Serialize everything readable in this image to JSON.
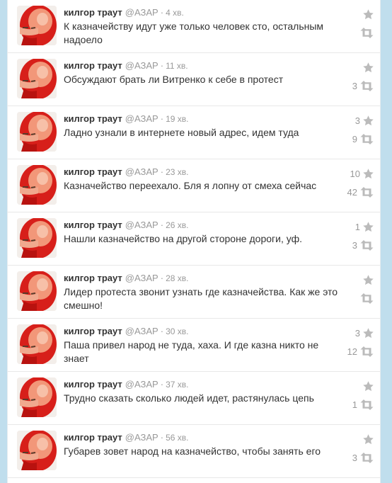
{
  "colors": {
    "background": "#c0deed",
    "icon": "#bbbbbb",
    "avatar_red": "#d71f1a",
    "avatar_skin": "#f29779"
  },
  "icons": {
    "favorite": "star-icon",
    "retweet": "retweet-icon"
  },
  "tweets": [
    {
      "name": "килгор траут",
      "handle": "@АЗАР",
      "time": "4 хв.",
      "text": "К казначейству идут уже только человек сто, остальным надоело",
      "favorites": "",
      "retweets": ""
    },
    {
      "name": "килгор траут",
      "handle": "@АЗАР",
      "time": "11 хв.",
      "text": "Обсуждают брать ли Витренко к себе в протест",
      "favorites": "",
      "retweets": "3"
    },
    {
      "name": "килгор траут",
      "handle": "@АЗАР",
      "time": "19 хв.",
      "text": "Ладно узнали в интернете новый адрес, идем туда",
      "favorites": "3",
      "retweets": "9"
    },
    {
      "name": "килгор траут",
      "handle": "@АЗАР",
      "time": "23 хв.",
      "text": "Казначейство переехало. Бля я лопну от смеха сейчас",
      "favorites": "10",
      "retweets": "42"
    },
    {
      "name": "килгор траут",
      "handle": "@АЗАР",
      "time": "26 хв.",
      "text": "Нашли казначейство на другой стороне дороги, уф.",
      "favorites": "1",
      "retweets": "3"
    },
    {
      "name": "килгор траут",
      "handle": "@АЗАР",
      "time": "28 хв.",
      "text": "Лидер протеста звонит узнать где казначейства. Как же это смешно!",
      "favorites": "",
      "retweets": ""
    },
    {
      "name": "килгор траут",
      "handle": "@АЗАР",
      "time": "30 хв.",
      "text": "Паша привел народ не туда, хаха. И где казна никто не знает",
      "favorites": "3",
      "retweets": "12"
    },
    {
      "name": "килгор траут",
      "handle": "@АЗАР",
      "time": "37 хв.",
      "text": "Трудно сказать сколько людей идет, растянулась цепь",
      "favorites": "",
      "retweets": "1"
    },
    {
      "name": "килгор траут",
      "handle": "@АЗАР",
      "time": "56 хв.",
      "text": "Губарев зовет народ на казначейство, чтобы занять его",
      "favorites": "",
      "retweets": "3"
    }
  ]
}
